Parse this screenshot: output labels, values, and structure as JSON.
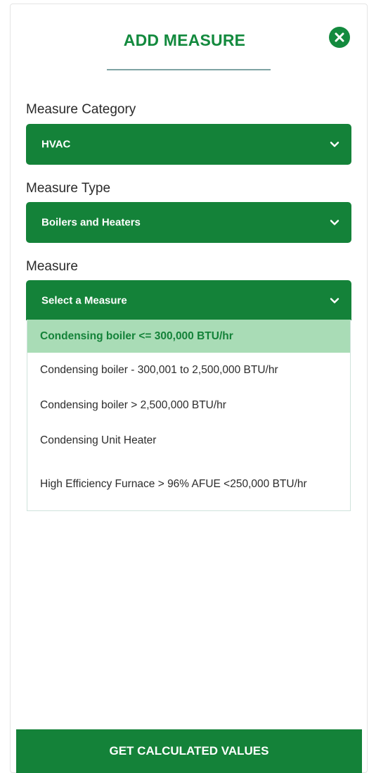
{
  "header": {
    "title": "ADD MEASURE",
    "close_icon": "close-icon"
  },
  "fields": [
    {
      "label": "Measure Category",
      "value": "HVAC"
    },
    {
      "label": "Measure Type",
      "value": "Boilers and Heaters"
    },
    {
      "label": "Measure",
      "value": "Select a Measure"
    }
  ],
  "dropdown": {
    "options": [
      "Condensing boiler <= 300,000 BTU/hr",
      "Condensing boiler - 300,001 to 2,500,000 BTU/hr",
      "Condensing boiler > 2,500,000 BTU/hr",
      "Condensing Unit Heater",
      "High Efficiency Furnace > 96% AFUE <250,000 BTU/hr"
    ],
    "highlighted_index": 0
  },
  "footer": {
    "button_label": "GET CALCULATED VALUES"
  },
  "colors": {
    "brand_green": "#148239",
    "highlight": "#a9dcb6",
    "title_green": "#138a3e"
  }
}
